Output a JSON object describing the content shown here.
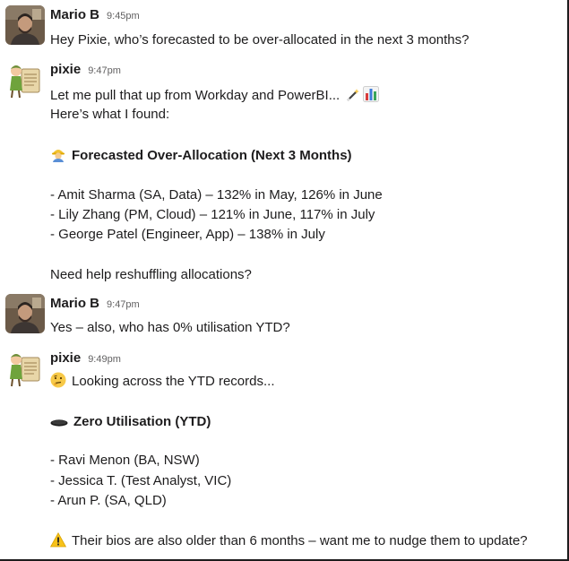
{
  "messages": [
    {
      "sender": "Mario B",
      "time": "9:45pm",
      "avatar": "person-photo",
      "text": "Hey Pixie, who’s forecasted to be over-allocated in the next 3 months?"
    },
    {
      "sender": "pixie",
      "time": "9:47pm",
      "avatar": "fairy-bot",
      "line1": "Let me pull that up from Workday and PowerBI...",
      "line1_icons": [
        "magic-wand-icon",
        "bar-chart-icon"
      ],
      "line2": "Here’s what I found:",
      "heading_icon": "worker-icon",
      "heading": "Forecasted Over-Allocation (Next 3 Months)",
      "items": [
        "- Amit Sharma (SA, Data) – 132% in May, 126% in June",
        "- Lily Zhang (PM, Cloud) – 121% in June, 117% in July",
        "- George Patel (Engineer, App) – 138% in July"
      ],
      "closing": "Need help reshuffling allocations?"
    },
    {
      "sender": "Mario B",
      "time": "9:47pm",
      "avatar": "person-photo",
      "text": "Yes – also, who has 0% utilisation YTD?"
    },
    {
      "sender": "pixie",
      "time": "9:49pm",
      "avatar": "fairy-bot",
      "line1_icon": "thinking-face-icon",
      "line1": "Looking across the YTD records...",
      "heading_icon": "hole-icon",
      "heading": "Zero Utilisation (YTD)",
      "items": [
        "- Ravi Menon (BA, NSW)",
        "- Jessica T. (Test Analyst, VIC)",
        "- Arun P. (SA, QLD)"
      ],
      "closing_icon": "warning-icon",
      "closing": "Their bios are also older than 6 months – want me to nudge them to update?"
    }
  ]
}
